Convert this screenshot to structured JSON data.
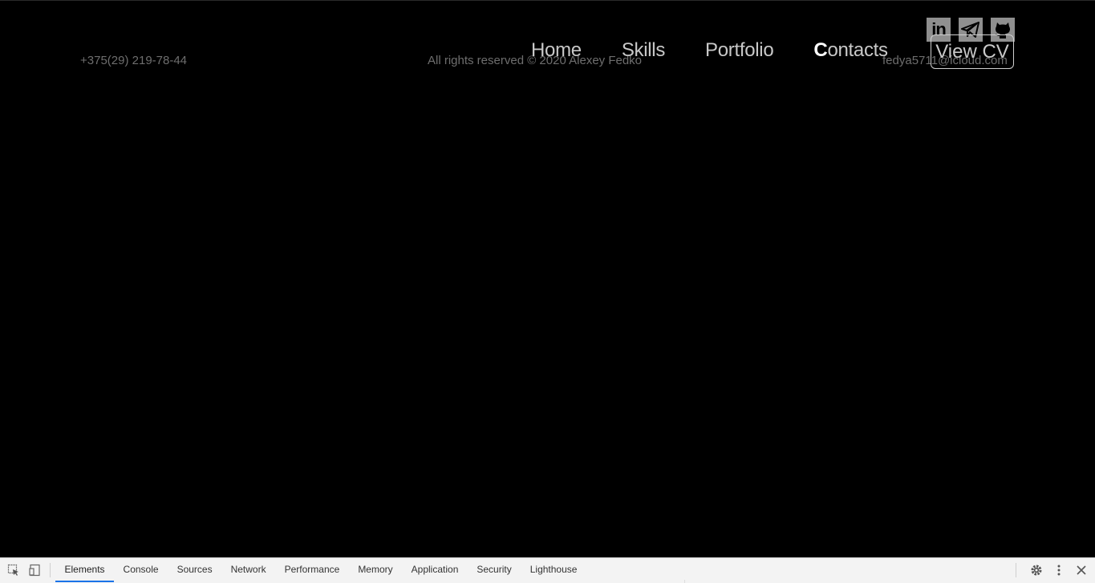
{
  "footer": {
    "phone": "+375(29) 219-78-44",
    "copyright": "All rights reserved © 2020 Alexey Fedko",
    "email": "fedya5711@icloud.com"
  },
  "social": {
    "icons": [
      "linkedin-icon",
      "telegram-icon",
      "github-icon"
    ],
    "linkedin_text": "in"
  },
  "nav": {
    "items": [
      "Home",
      "Skills",
      "Portfolio",
      "Contacts"
    ],
    "active": "Contacts",
    "cv_label": "View CV"
  },
  "devtools": {
    "tabs": [
      "Elements",
      "Console",
      "Sources",
      "Network",
      "Performance",
      "Memory",
      "Application",
      "Security",
      "Lighthouse"
    ],
    "active_tab": "Elements"
  },
  "colors": {
    "background": "#000000",
    "nav_text": "#c8c8c8",
    "footer_text": "#6e6e6e",
    "devtools_accent": "#1a73e8"
  }
}
